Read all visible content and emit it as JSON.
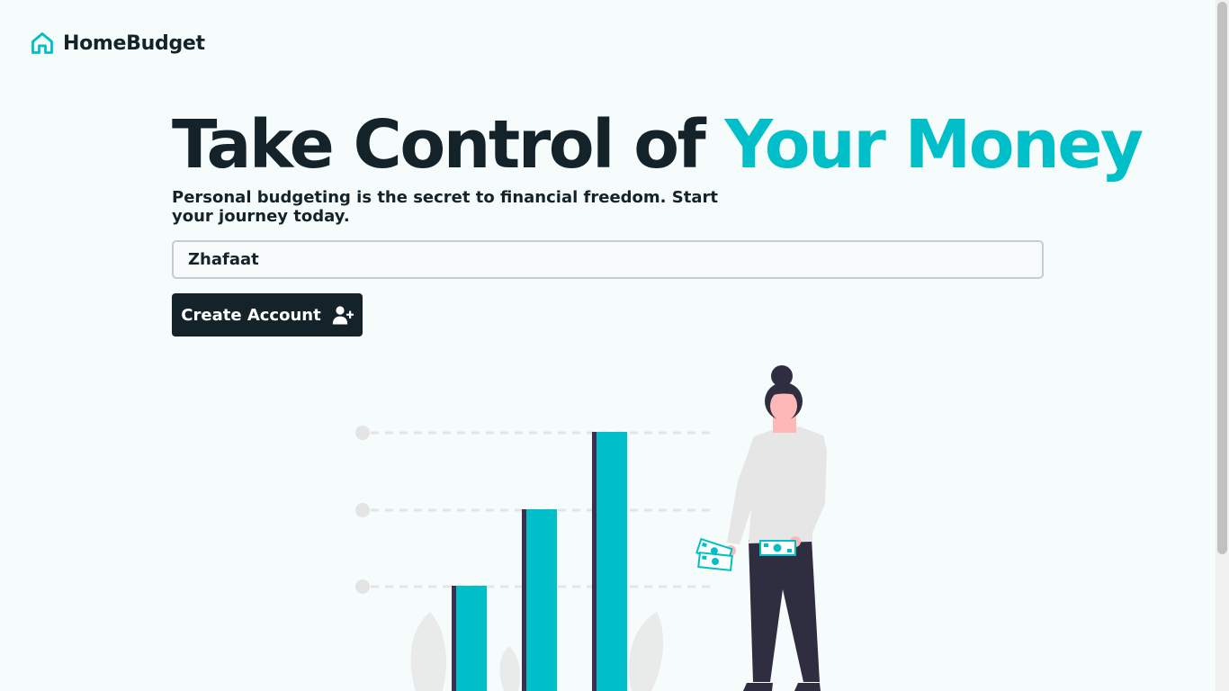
{
  "brand": {
    "name": "HomeBudget",
    "icon": "home-icon",
    "color": "#00bfc8"
  },
  "hero": {
    "title_main": "Take Control of ",
    "title_accent": "Your Money",
    "subtitle": "Personal budgeting is the secret to financial freedom. Start your journey today."
  },
  "form": {
    "name_value": "Zhafaat",
    "create_label": "Create Account",
    "create_icon": "user-plus-icon"
  },
  "colors": {
    "accent": "#00bfc8",
    "dark": "#14232a",
    "background": "#f6fbfc"
  }
}
